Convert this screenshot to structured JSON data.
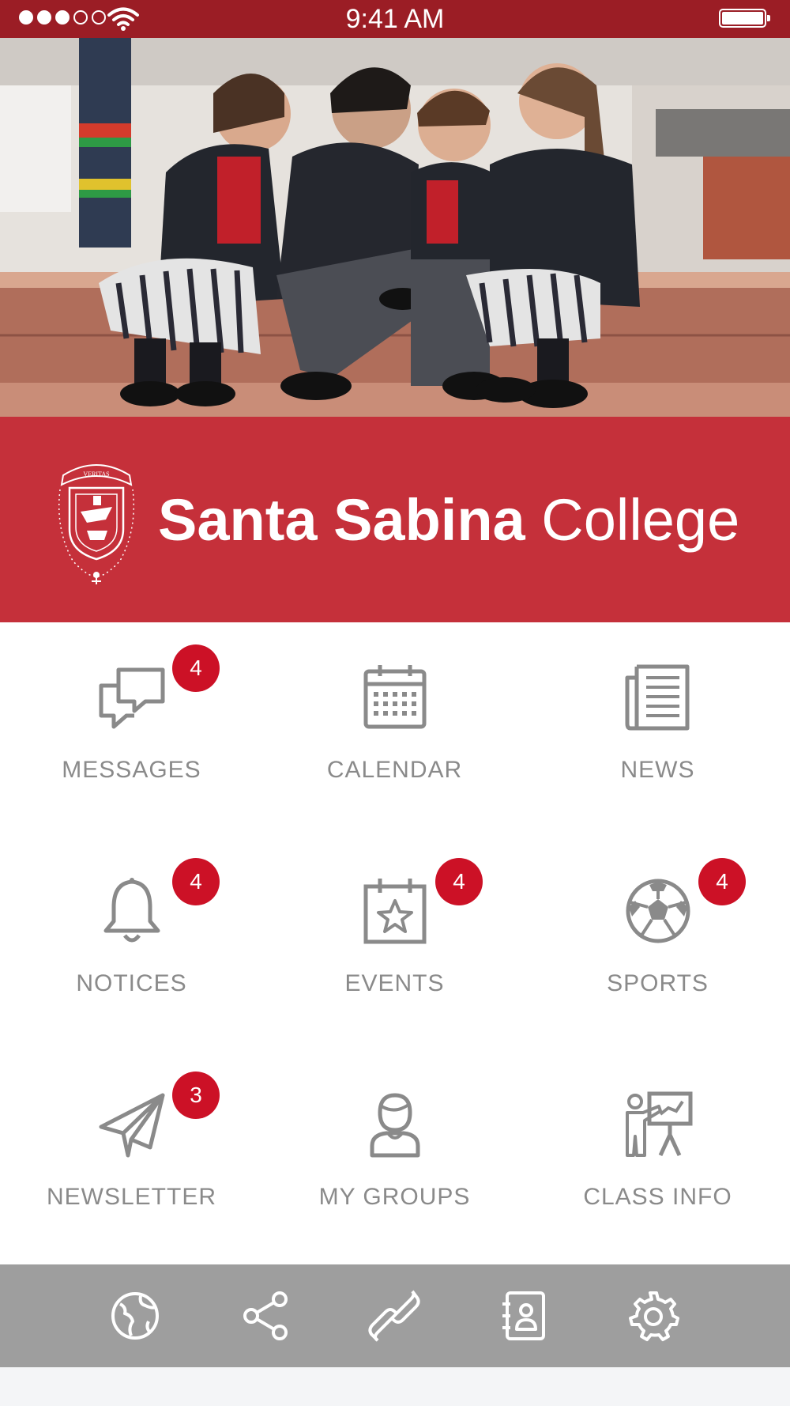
{
  "status_bar": {
    "time": "9:41 AM",
    "signal_dots_filled": 3,
    "signal_dots_total": 5,
    "battery_level": 1.0
  },
  "header": {
    "college_name_bold": "Santa Sabina",
    "college_name_light": "College",
    "crest_motto": "VERITAS"
  },
  "colors": {
    "status_bar": "#9b1d25",
    "banner": "#c5303a",
    "badge": "#cc1126",
    "icon_gray": "#8a8a8a",
    "tab_bar": "#9e9e9e"
  },
  "tiles": [
    {
      "label": "MESSAGES",
      "icon": "chat-bubbles-icon",
      "badge": "4"
    },
    {
      "label": "CALENDAR",
      "icon": "calendar-icon",
      "badge": ""
    },
    {
      "label": "NEWS",
      "icon": "newspaper-icon",
      "badge": ""
    },
    {
      "label": "NOTICES",
      "icon": "bell-icon",
      "badge": "4"
    },
    {
      "label": "EVENTS",
      "icon": "calendar-star-icon",
      "badge": "4"
    },
    {
      "label": "SPORTS",
      "icon": "soccer-ball-icon",
      "badge": "4"
    },
    {
      "label": "NEWSLETTER",
      "icon": "paper-plane-icon",
      "badge": "3"
    },
    {
      "label": "MY GROUPS",
      "icon": "person-icon",
      "badge": ""
    },
    {
      "label": "CLASS INFO",
      "icon": "teacher-board-icon",
      "badge": ""
    }
  ],
  "tab_bar": [
    {
      "icon": "globe-icon"
    },
    {
      "icon": "share-icon"
    },
    {
      "icon": "link-icon"
    },
    {
      "icon": "contacts-book-icon"
    },
    {
      "icon": "settings-gear-icon"
    }
  ]
}
